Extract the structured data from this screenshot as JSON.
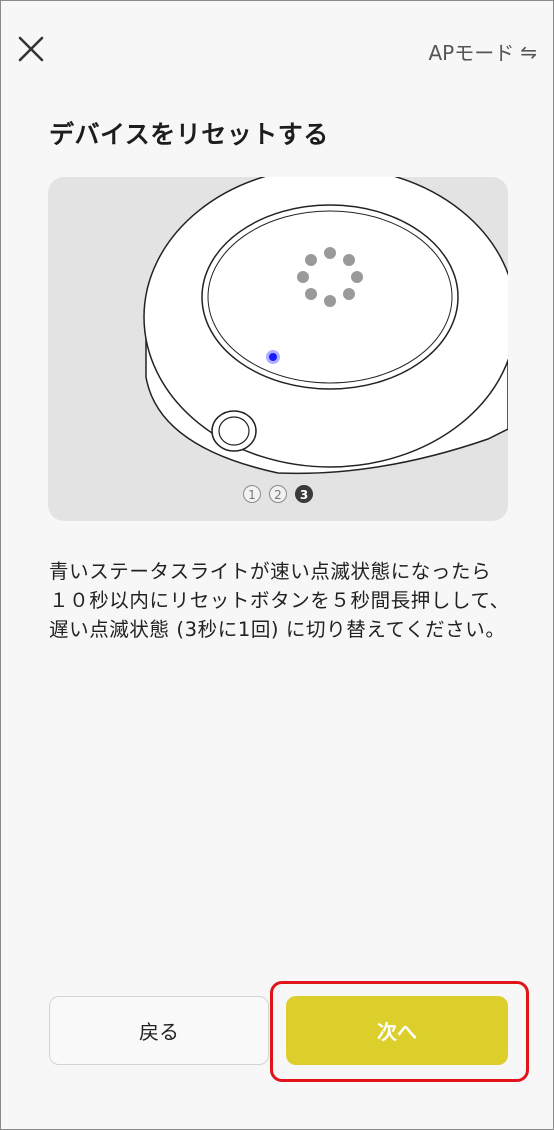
{
  "header": {
    "close_icon": "close-icon",
    "ap_mode_label": "APモード",
    "ap_mode_icon": "swap-arrows-icon"
  },
  "title": "デバイスをリセットする",
  "illustration": {
    "led_color": "#1a1aff",
    "pager": {
      "steps": [
        "1",
        "2",
        "3"
      ],
      "current": "3"
    }
  },
  "instruction": "青いステータスライトが速い点滅状態になったら１０秒以内にリセットボタンを５秒間長押しして、遅い点滅状態 (3秒に1回) に切り替えてください。",
  "buttons": {
    "back_label": "戻る",
    "next_label": "次へ"
  },
  "colors": {
    "next_button": "#dcce2b",
    "highlight_border": "#e2141b"
  }
}
